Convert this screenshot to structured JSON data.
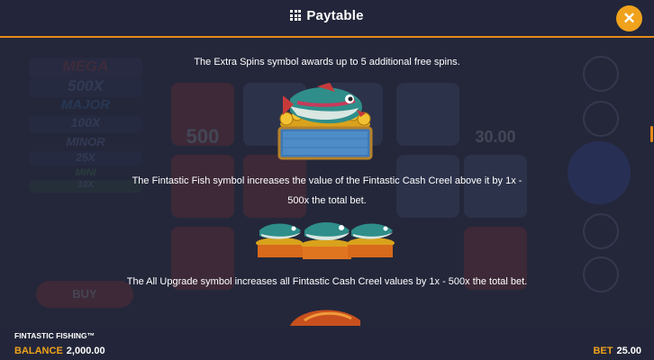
{
  "header": {
    "title": "Paytable",
    "menu_icon": "grid-icon",
    "close_icon": "close-icon",
    "close_glyph": "✕"
  },
  "background": {
    "jackpots": [
      "MEGA",
      "500X",
      "MAJOR",
      "100X",
      "MINOR",
      "25X",
      "MINI",
      "10X"
    ],
    "reel_values": [
      "500",
      "30.00"
    ],
    "buy_label": "BUY"
  },
  "paytable": {
    "extra_spins_text": "The Extra Spins symbol awards up to 5 additional free spins.",
    "fantastic_fish_text": "The Fintastic Fish symbol increases the value of the Fintastic Cash Creel above it by 1x - 500x the total bet.",
    "all_upgrade_text": "The All Upgrade symbol increases all Fintastic Cash Creel values by 1x - 500x the total bet."
  },
  "footer": {
    "game_name": "FINTASTIC FISHING™",
    "balance_label": "BALANCE",
    "balance_value": "2,000.00",
    "bet_label": "BET",
    "bet_value": "25.00"
  },
  "colors": {
    "accent": "#f0a21c",
    "divider": "#e88a1a",
    "background": "#24273a"
  }
}
